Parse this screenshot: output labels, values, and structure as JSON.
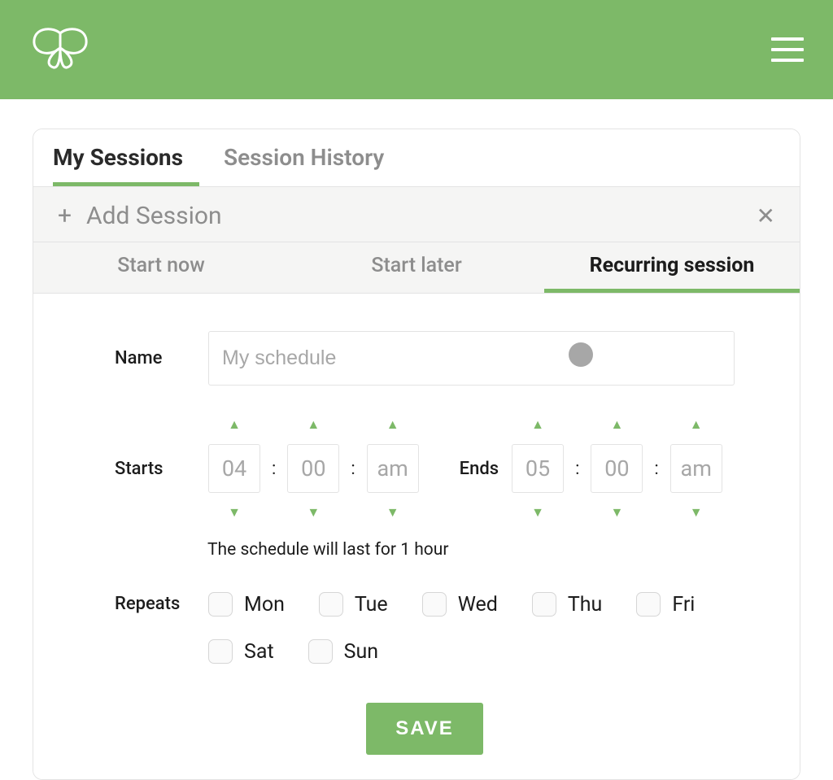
{
  "colors": {
    "accent": "#7db968",
    "muted": "#8d8d8d",
    "border": "#e3e3e3"
  },
  "tabs": {
    "items": [
      {
        "label": "My Sessions",
        "active": true
      },
      {
        "label": "Session History",
        "active": false
      }
    ]
  },
  "addSession": {
    "label": "Add Session"
  },
  "subtabs": {
    "items": [
      {
        "label": "Start now",
        "active": false
      },
      {
        "label": "Start later",
        "active": false
      },
      {
        "label": "Recurring session",
        "active": true
      }
    ]
  },
  "form": {
    "nameLabel": "Name",
    "namePlaceholder": "My schedule",
    "nameValue": "",
    "startsLabel": "Starts",
    "endsLabel": "Ends",
    "startTime": {
      "hour": "04",
      "minute": "00",
      "period": "am"
    },
    "endTime": {
      "hour": "05",
      "minute": "00",
      "period": "am"
    },
    "durationNote": "The schedule will last for 1 hour",
    "repeatsLabel": "Repeats",
    "days": [
      {
        "label": "Mon",
        "checked": false
      },
      {
        "label": "Tue",
        "checked": false
      },
      {
        "label": "Wed",
        "checked": false
      },
      {
        "label": "Thu",
        "checked": false
      },
      {
        "label": "Fri",
        "checked": false
      },
      {
        "label": "Sat",
        "checked": false
      },
      {
        "label": "Sun",
        "checked": false
      }
    ],
    "saveLabel": "SAVE"
  }
}
